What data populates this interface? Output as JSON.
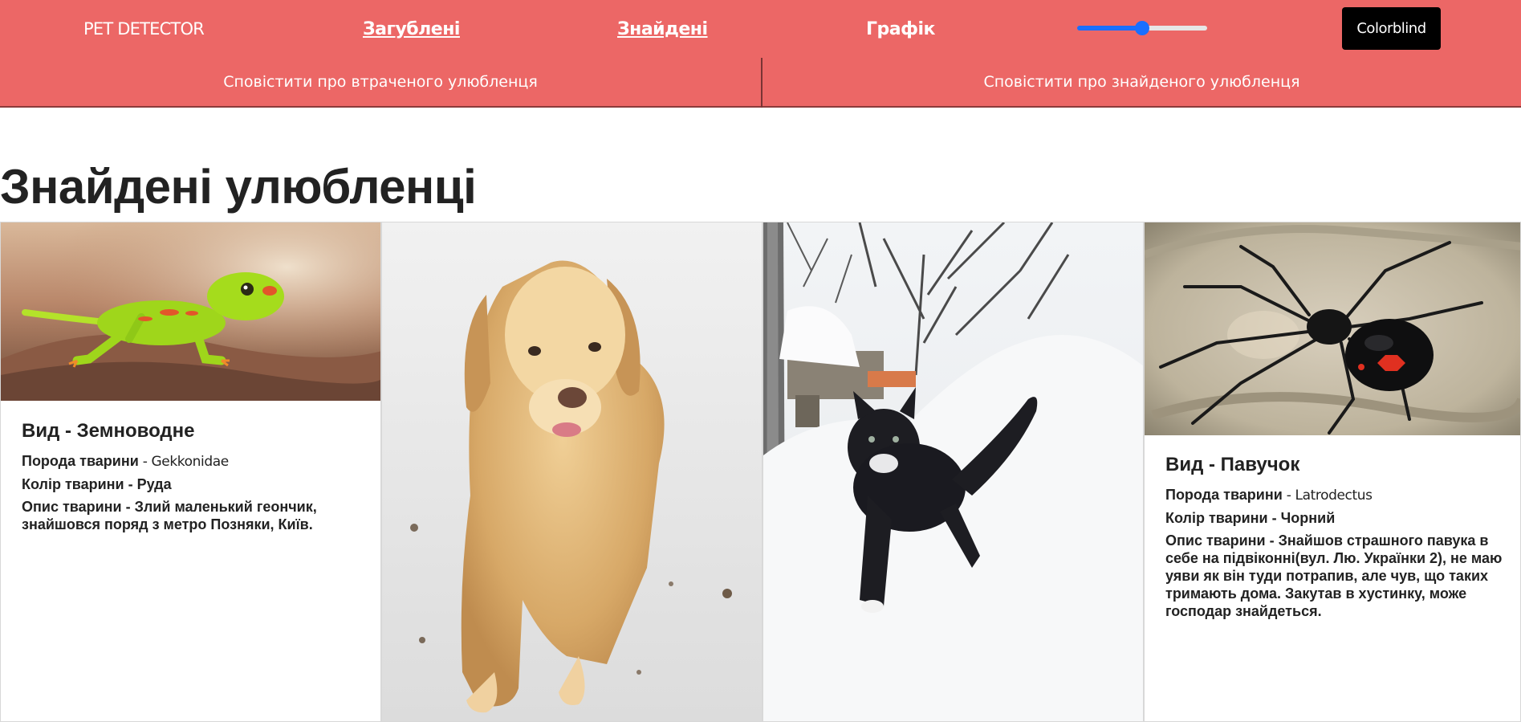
{
  "nav": {
    "brand": "PET DETECTOR",
    "lost": "Загублені",
    "found": "Знайдені",
    "chart": "Графік",
    "slider_value": 0.5,
    "colorblind": "Colorblind"
  },
  "subnav": {
    "report_lost": "Сповістити про втраченого улюбленця",
    "report_found": "Сповістити про знайденого улюбленця"
  },
  "page": {
    "title": "Знайдені улюбленці"
  },
  "colors": {
    "header_bg": "#ec6766",
    "accent": "#1a6fff",
    "button_bg": "#000000"
  },
  "pets": [
    {
      "species_label": "Вид - Земноводне",
      "breed_label": "Порода тварини",
      "breed_sep": " - ",
      "breed": "Gekkonidae",
      "color_line": "Колір тварини - Руда",
      "description_line": "Опис тварини - Злий маленький геончик, знайшовся поряд з метро Позняки, Київ."
    },
    {
      "image_icon": "golden-retriever-in-snow"
    },
    {
      "image_icon": "black-cat-in-snow"
    },
    {
      "species_label": "Вид - Павучок",
      "breed_label": "Порода тварини",
      "breed_sep": " - ",
      "breed": "Latrodectus",
      "color_line": "Колір тварини - Чорний",
      "description_line": "Опис тварини - Знайшов страшного павука в себе на підвіконні(вул. Лю. Українки 2), не маю уяви як він туди потрапив, але чув, що таких тримають дома. Закутав в хустинку, може господар знайдеться."
    }
  ]
}
